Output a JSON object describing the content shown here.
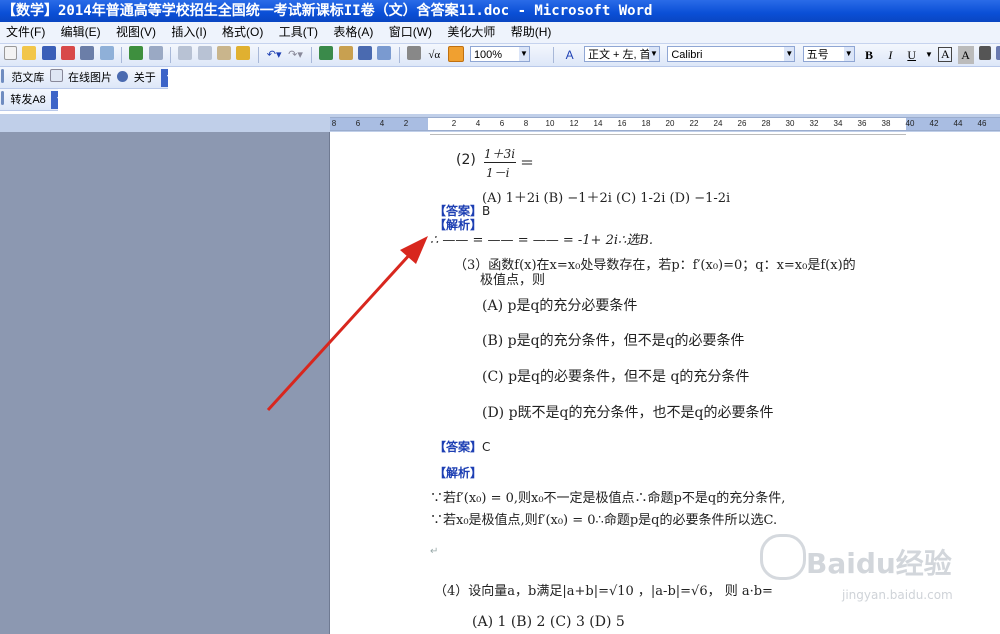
{
  "window": {
    "title": "【数学】2014年普通高等学校招生全国统一考试新课标II卷（文）含答案11.doc - Microsoft Word"
  },
  "menubar": {
    "items": [
      "文件(F)",
      "编辑(E)",
      "视图(V)",
      "插入(I)",
      "格式(O)",
      "工具(T)",
      "表格(A)",
      "窗口(W)",
      "美化大师",
      "帮助(H)"
    ]
  },
  "toolbar": {
    "zoom": "100%",
    "style": "正文 + 左, 首",
    "font": "Calibri",
    "size": "五号",
    "bold": "B",
    "italic": "I",
    "underline": "U",
    "char_border": "A",
    "char_shade": "A"
  },
  "toolbar2": {
    "template_label": "范文库",
    "online_images_label": "在线图片",
    "about_label": "关于"
  },
  "toolbar3": {
    "forward_label": "转发A8"
  },
  "ruler": {
    "ticks": [
      "8",
      "6",
      "4",
      "2",
      "2",
      "4",
      "6",
      "8",
      "10",
      "12",
      "14",
      "16",
      "18",
      "20",
      "22",
      "24",
      "26",
      "28",
      "30",
      "32",
      "34",
      "36",
      "38",
      "40",
      "42",
      "44",
      "46"
    ]
  },
  "doc": {
    "q2_number": "(2)",
    "q2_numerator": "1＋3i",
    "q2_denominator": "1－i",
    "q2_equals": "＝",
    "q2_options": "(A)  1＋2i        (B)  −1＋2i        (C)  1-2i     (D)  −1-2i",
    "answer_tag": "【答案】",
    "answer_2": "B",
    "analysis_tag": "【解析】",
    "analysis_2": "∴  —— = ——  = ——  = -1+ 2i∴选B.",
    "q3_stem_1": "（3）函数f(x)在x=x₀处导数存在，若p：f′(x₀)=0；q：x=x₀是f(x)的",
    "q3_stem_2": "极值点，则",
    "q3_a": "(A)  p是q的充分必要条件",
    "q3_b": "(B)  p是q的充分条件，但不是q的必要条件",
    "q3_c": "(C)  p是q的必要条件，但不是 q的充分条件",
    "q3_d": "(D)  p既不是q的充分条件，也不是q的必要条件",
    "answer_3": "C",
    "analysis_3_line1": "∵若f′(x₀) = 0,则x₀不一定是极值点∴命题p不是q的充分条件,",
    "analysis_3_line2": "∵若x₀是极值点,则f′(x₀) = 0∴命题p是q的必要条件所以选C.",
    "q4_stem": "（4）设向量a，b满足|a+b|=√10 ，|a-b|=√6， 则 a·b=",
    "q4_options": "(A)  1          (B)   2          (C)  3         (D)  5"
  },
  "watermark": {
    "brand": "Baidu经验",
    "url": "jingyan.baidu.com"
  },
  "colors": {
    "titlebar": "#0a4fd6",
    "tag_blue": "#1d3fb3",
    "arrow_red": "#d8271e",
    "side_pane": "#8c98b1"
  }
}
